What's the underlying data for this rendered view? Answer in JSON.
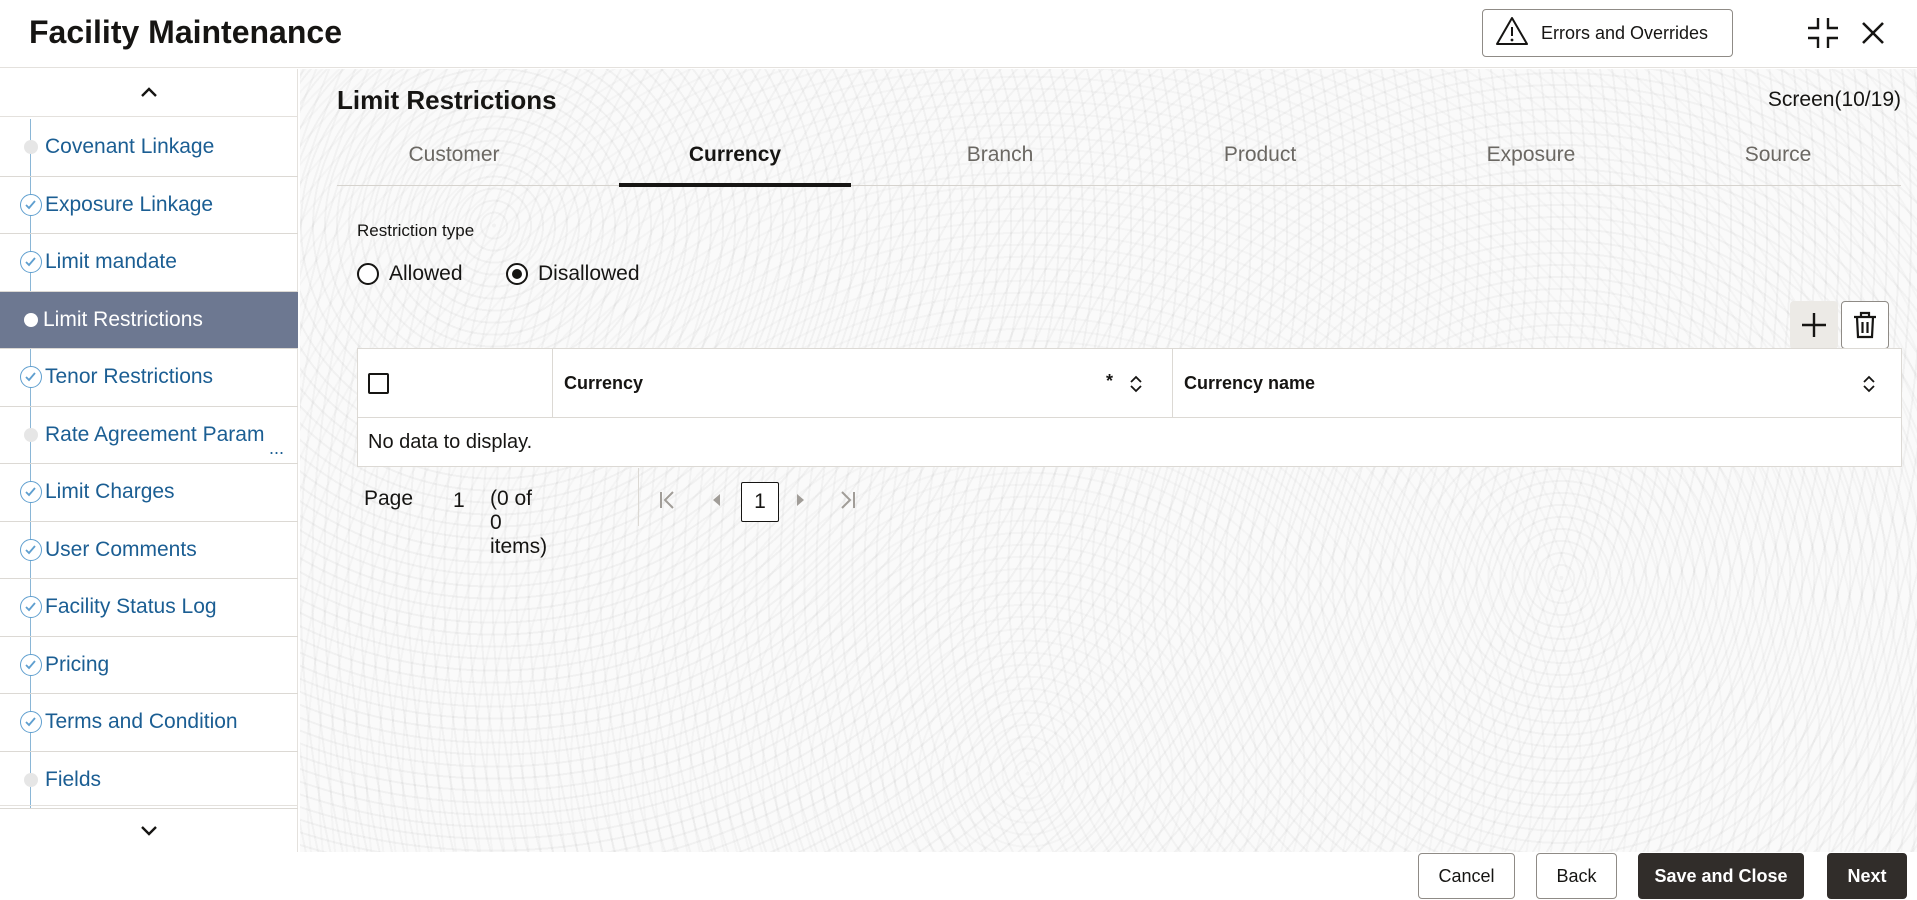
{
  "header": {
    "title": "Facility Maintenance",
    "errors_button": "Errors and Overrides"
  },
  "sidebar": {
    "items": [
      {
        "label": "Covenant Linkage",
        "state": "pending"
      },
      {
        "label": "Exposure Linkage",
        "state": "done"
      },
      {
        "label": "Limit mandate",
        "state": "done"
      },
      {
        "label": "Limit Restrictions",
        "state": "active"
      },
      {
        "label": "Tenor Restrictions",
        "state": "done"
      },
      {
        "label": "Rate Agreement Param",
        "state": "pending",
        "ellipsis": "..."
      },
      {
        "label": "Limit Charges",
        "state": "done"
      },
      {
        "label": "User Comments",
        "state": "done"
      },
      {
        "label": "Facility Status Log",
        "state": "done"
      },
      {
        "label": "Pricing",
        "state": "done"
      },
      {
        "label": "Terms and Condition",
        "state": "done"
      },
      {
        "label": "Fields",
        "state": "pending"
      }
    ]
  },
  "main": {
    "title": "Limit Restrictions",
    "screen": "Screen(10/19)",
    "tabs": [
      {
        "label": "Customer"
      },
      {
        "label": "Currency",
        "active": true
      },
      {
        "label": "Branch"
      },
      {
        "label": "Product"
      },
      {
        "label": "Exposure"
      },
      {
        "label": "Source"
      }
    ],
    "restriction": {
      "label": "Restriction type",
      "options": [
        "Allowed",
        "Disallowed"
      ],
      "selected": "Disallowed"
    },
    "grid": {
      "columns": [
        "Currency",
        "Currency name"
      ],
      "required_mark": "*",
      "empty_text": "No data to display."
    },
    "pager": {
      "label": "Page",
      "page": "1",
      "info": "(0 of 0 items)",
      "current": "1"
    }
  },
  "footer": {
    "cancel": "Cancel",
    "back": "Back",
    "save_close": "Save and Close",
    "next": "Next"
  }
}
